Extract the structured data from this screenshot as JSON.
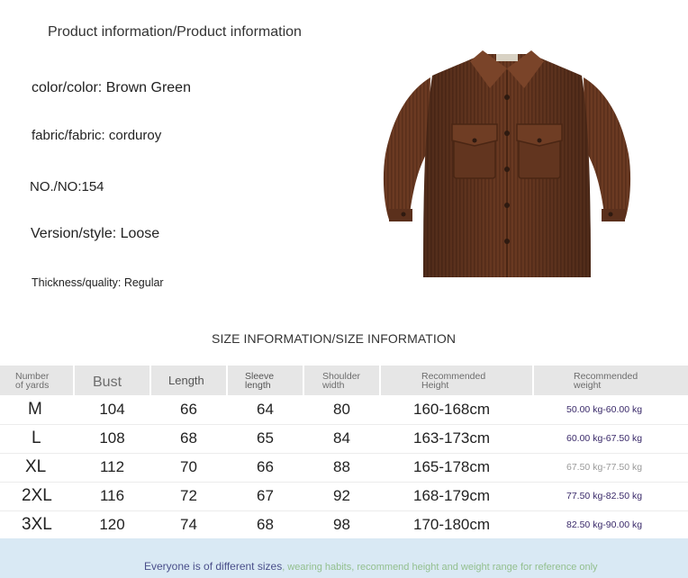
{
  "title": "Product information/Product information",
  "specs": {
    "color": "color/color: Brown Green",
    "fabric": "fabric/fabric: corduroy",
    "number": "NO./NO:154",
    "version": "Version/style: Loose",
    "thickness": "Thickness/quality: Regular"
  },
  "colors": {
    "jacket": "#6b3a22",
    "header_bg": "#e6e6e6",
    "footer_bg": "#d9e9f4"
  },
  "size_title": "SIZE INFORMATION/SIZE INFORMATION",
  "table": {
    "headers": {
      "size_line1": "Number",
      "size_line2": "of yards",
      "bust": "Bust",
      "length": "Length",
      "sleeve_line1": "Sleeve",
      "sleeve_line2": "length",
      "shoulder_line1": "Shoulder",
      "shoulder_line2": "width",
      "height_line1": "Recommended",
      "height_line2": "Height",
      "weight_line1": "Recommended",
      "weight_line2": "weight"
    },
    "rows": [
      {
        "size": "M",
        "bust": "104",
        "length": "66",
        "sleeve": "64",
        "shoulder": "80",
        "height": "160-168cm",
        "weight": "50.00 kg-60.00 kg"
      },
      {
        "size": "L",
        "bust": "108",
        "length": "68",
        "sleeve": "65",
        "shoulder": "84",
        "height": "163-173cm",
        "weight": "60.00 kg-67.50 kg"
      },
      {
        "size": "XL",
        "bust": "112",
        "length": "70",
        "sleeve": "66",
        "shoulder": "88",
        "height": "165-178cm",
        "weight": "67.50 kg-77.50 kg"
      },
      {
        "size": "2XL",
        "bust": "116",
        "length": "72",
        "sleeve": "67",
        "shoulder": "92",
        "height": "168-179cm",
        "weight": "77.50 kg-82.50 kg"
      },
      {
        "size": "3XL",
        "bust": "120",
        "length": "74",
        "sleeve": "68",
        "shoulder": "98",
        "height": "170-180cm",
        "weight": "82.50 kg-90.00 kg"
      }
    ]
  },
  "footer": {
    "main": "Everyone is of different sizes",
    "rest": ", wearing habits, recommend height and weight range for reference only"
  }
}
